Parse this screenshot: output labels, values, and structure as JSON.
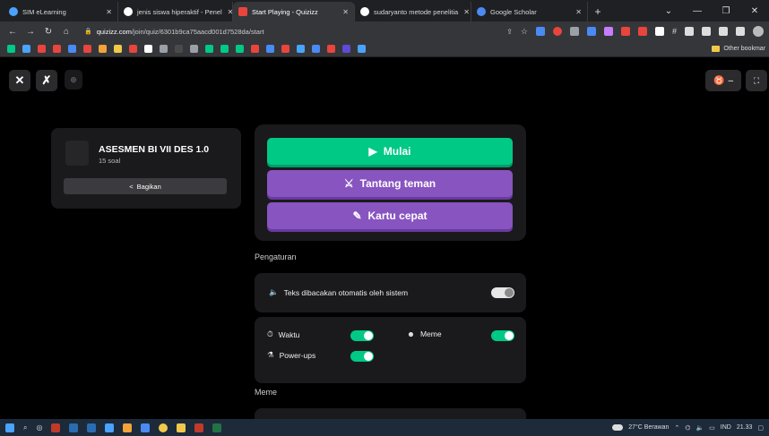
{
  "browser": {
    "tabs": [
      {
        "label": "SIM eLearning",
        "color": "#4aa3ff",
        "active": false
      },
      {
        "label": "jenis siswa hiperaktif - Penel",
        "color": "#ffffff",
        "active": false
      },
      {
        "label": "Start Playing - Quizizz",
        "color": "#e8453c",
        "active": true
      },
      {
        "label": "sudaryanto metode penelitia",
        "color": "#ffffff",
        "active": false
      },
      {
        "label": "Google Scholar",
        "color": "#4a8af4",
        "active": false
      }
    ],
    "new_tab_icon": "plus-icon",
    "url_host": "quizizz.com",
    "url_path": "/join/quiz/6301b9ca75aacd001d7528da/start",
    "other_bookmarks": "Other bookmar"
  },
  "page": {
    "close_label": "✕",
    "theme_symbol": "♉",
    "quiz": {
      "title": "ASESMEN BI VII DES 1.0",
      "count": "15 soal",
      "share_label": "Bagikan"
    },
    "actions": {
      "start": "Mulai",
      "challenge": "Tantang teman",
      "flashcards": "Kartu cepat"
    },
    "settings_heading": "Pengaturan",
    "settings": {
      "read_aloud": {
        "label": "Teks dibacakan otomatis oleh sistem",
        "on": false
      },
      "timer": {
        "label": "Waktu",
        "on": true
      },
      "meme": {
        "label": "Meme",
        "on": true
      },
      "powerups": {
        "label": "Power-ups",
        "on": true
      }
    },
    "meme_heading": "Meme"
  },
  "taskbar": {
    "weather": "27°C Berawan",
    "lang": "IND",
    "time": "21.33"
  },
  "colors": {
    "green": "#00c985",
    "purple": "#8854c0",
    "panel": "#1a1a1c"
  }
}
